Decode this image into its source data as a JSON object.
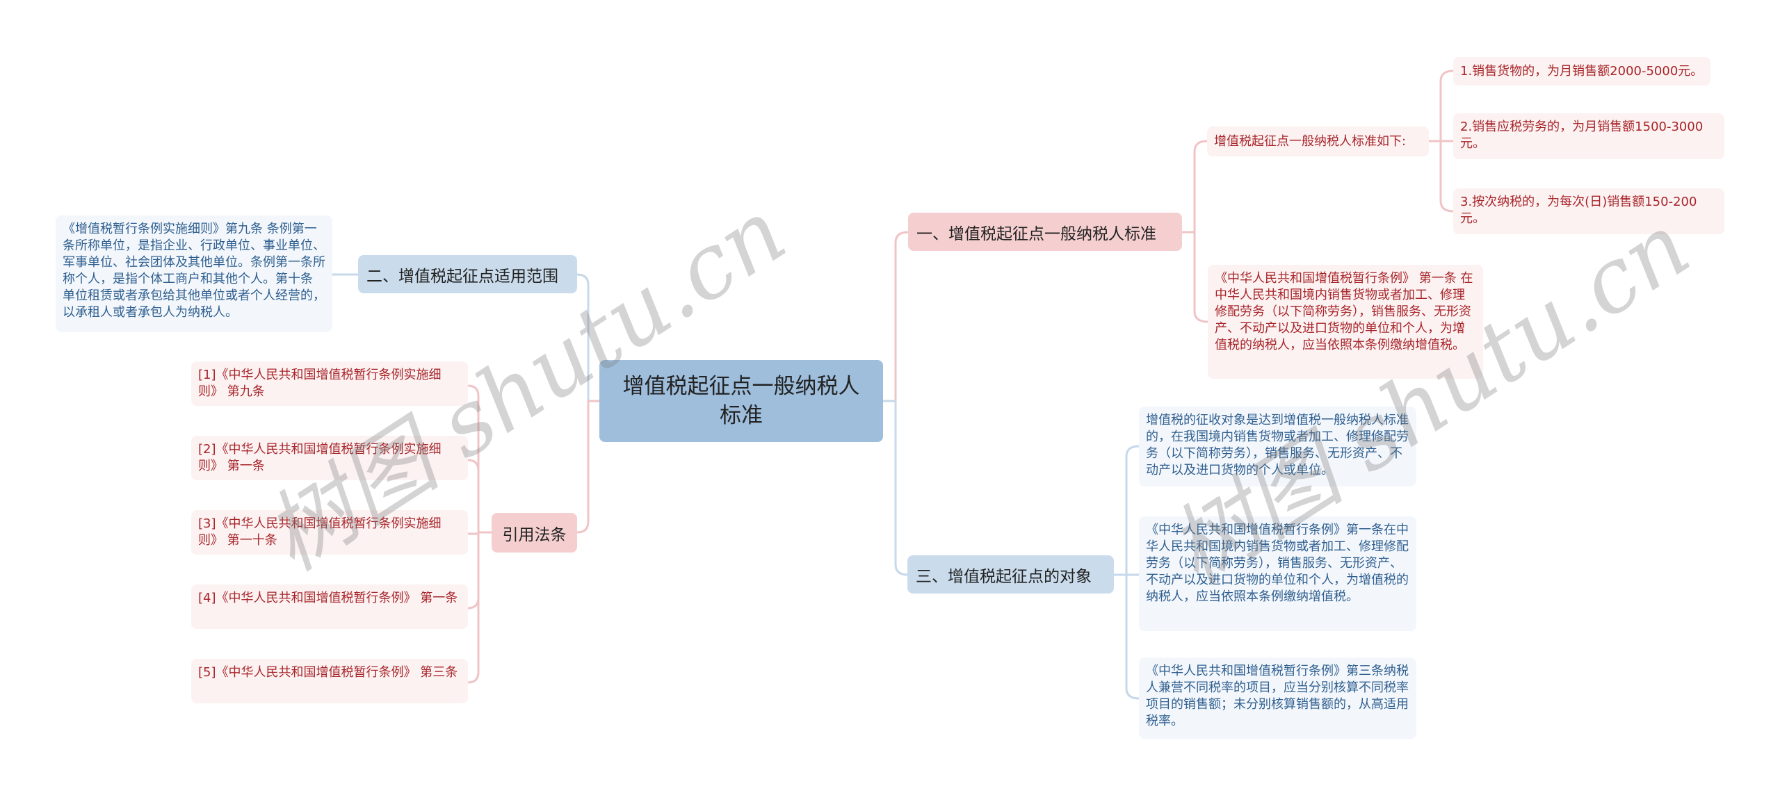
{
  "root": {
    "title": "增值税起征点一般纳税人标准"
  },
  "branches": {
    "standard": {
      "label": "一、增值税起征点一般纳税人标准",
      "intro": "增值税起征点一般纳税人标准如下:",
      "items": [
        "1.销售货物的，为月销售额2000-5000元。",
        "2.销售应税劳务的，为月销售额1500-3000元。",
        "3.按次纳税的，为每次(日)销售额150-200元。"
      ],
      "quote": "《中华人民共和国增值税暂行条例》 第一条 在中华人民共和国境内销售货物或者加工、修理修配劳务（以下简称劳务），销售服务、无形资产、不动产以及进口货物的单位和个人，为增值税的纳税人，应当依照本条例缴纳增值税。"
    },
    "scope": {
      "label": "二、增值税起征点适用范围",
      "detail": "《增值税暂行条例实施细则》第九条 条例第一条所称单位，是指企业、行政单位、事业单位、军事单位、社会团体及其他单位。条例第一条所称个人，是指个体工商户和其他个人。第十条 单位租赁或者承包给其他单位或者个人经营的，以承租人或者承包人为纳税人。"
    },
    "object": {
      "label": "三、增值税起征点的对象",
      "items": [
        "增值税的征收对象是达到增值税一般纳税人标准的，在我国境内销售货物或者加工、修理修配劳务（以下简称劳务），销售服务、无形资产、不动产以及进口货物的个人或单位。",
        "《中华人民共和国增值税暂行条例》第一条在中华人民共和国境内销售货物或者加工、修理修配劳务（以下简称劳务），销售服务、无形资产、不动产以及进口货物的单位和个人，为增值税的纳税人，应当依照本条例缴纳增值税。",
        "《中华人民共和国增值税暂行条例》第三条纳税人兼营不同税率的项目，应当分别核算不同税率项目的销售额；未分别核算销售额的，从高适用税率。"
      ]
    },
    "citations": {
      "label": "引用法条",
      "items": [
        "[1]《中华人民共和国增值税暂行条例实施细则》 第九条",
        "[2]《中华人民共和国增值税暂行条例实施细则》 第一条",
        "[3]《中华人民共和国增值税暂行条例实施细则》 第一十条",
        "[4]《中华人民共和国增值税暂行条例》 第一条",
        "[5]《中华人民共和国增值税暂行条例》 第三条"
      ]
    }
  },
  "watermarks": [
    "树图 shutu.cn",
    "树图 shutu.cn"
  ],
  "colors": {
    "root_fill": "#9ebedc",
    "blue_branch_fill": "#cadcec",
    "red_branch_fill": "#f5cfd0",
    "blue_leaf_text": "#2f5f8f",
    "red_leaf_text": "#a8252a",
    "blue_link": "#c6d8ea",
    "red_link": "#f0c4c6"
  }
}
